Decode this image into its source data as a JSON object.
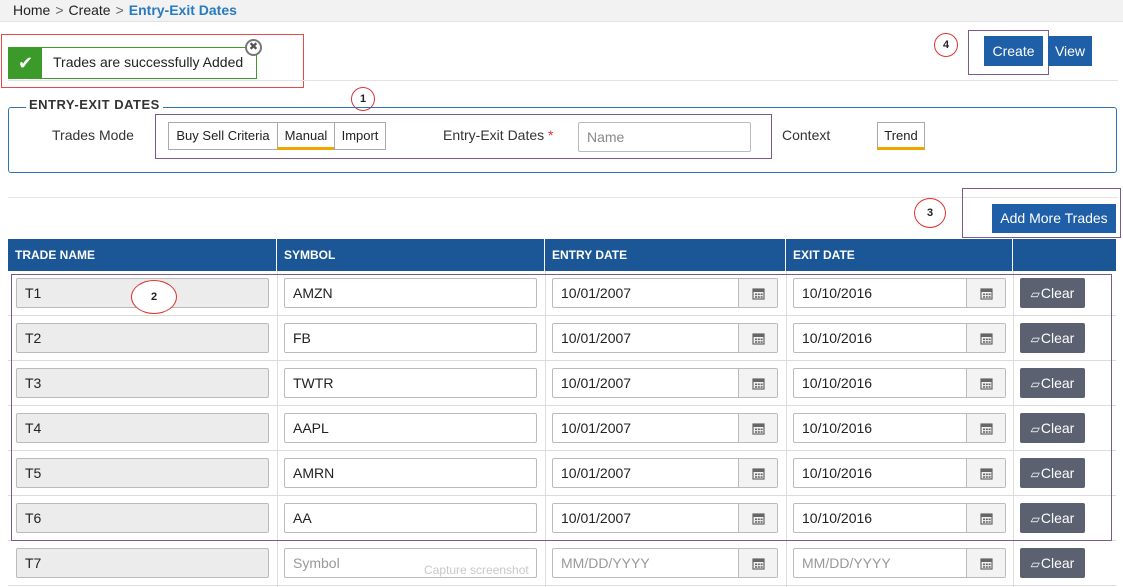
{
  "breadcrumb": {
    "home": "Home",
    "create": "Create",
    "current": "Entry-Exit Dates",
    "sep": ">"
  },
  "alert": {
    "message": "Trades are successfully Added",
    "check_icon": "✔",
    "close_icon": "✖"
  },
  "callouts": {
    "c1": "1",
    "c2": "2",
    "c3": "3",
    "c4": "4"
  },
  "toolbar": {
    "create": "Create",
    "view": "View"
  },
  "form": {
    "legend": "ENTRY-EXIT DATES",
    "trades_mode_label": "Trades Mode",
    "modes": [
      "Buy Sell Criteria",
      "Manual",
      "Import"
    ],
    "active_mode": "Manual",
    "entry_exit_label": "Entry-Exit Dates",
    "required_mark": "*",
    "name_placeholder": "Name",
    "context_label": "Context",
    "context_value": "Trend"
  },
  "add_more_trades": "Add More Trades",
  "table": {
    "headers": [
      "TRADE NAME",
      "SYMBOL",
      "ENTRY DATE",
      "EXIT DATE",
      ""
    ],
    "clear_label": "Clear",
    "clear_icon": "eraser-icon",
    "rows": [
      {
        "name": "T1",
        "symbol": "AMZN",
        "entry": "10/01/2007",
        "exit": "10/10/2016"
      },
      {
        "name": "T2",
        "symbol": "FB",
        "entry": "10/01/2007",
        "exit": "10/10/2016"
      },
      {
        "name": "T3",
        "symbol": "TWTR",
        "entry": "10/01/2007",
        "exit": "10/10/2016"
      },
      {
        "name": "T4",
        "symbol": "AAPL",
        "entry": "10/01/2007",
        "exit": "10/10/2016"
      },
      {
        "name": "T5",
        "symbol": "AMRN",
        "entry": "10/01/2007",
        "exit": "10/10/2016"
      },
      {
        "name": "T6",
        "symbol": "AA",
        "entry": "10/01/2007",
        "exit": "10/10/2016"
      },
      {
        "name": "T7",
        "symbol": "",
        "entry": "",
        "exit": ""
      }
    ],
    "placeholders": {
      "symbol": "Symbol",
      "date": "MM/DD/YYYY"
    }
  },
  "watermark": "Capture screenshot",
  "colors": {
    "primary": "#1f5fa8",
    "header": "#1b5797",
    "success": "#3c9a2b",
    "accent": "#f0a500",
    "clear": "#5b6170"
  }
}
